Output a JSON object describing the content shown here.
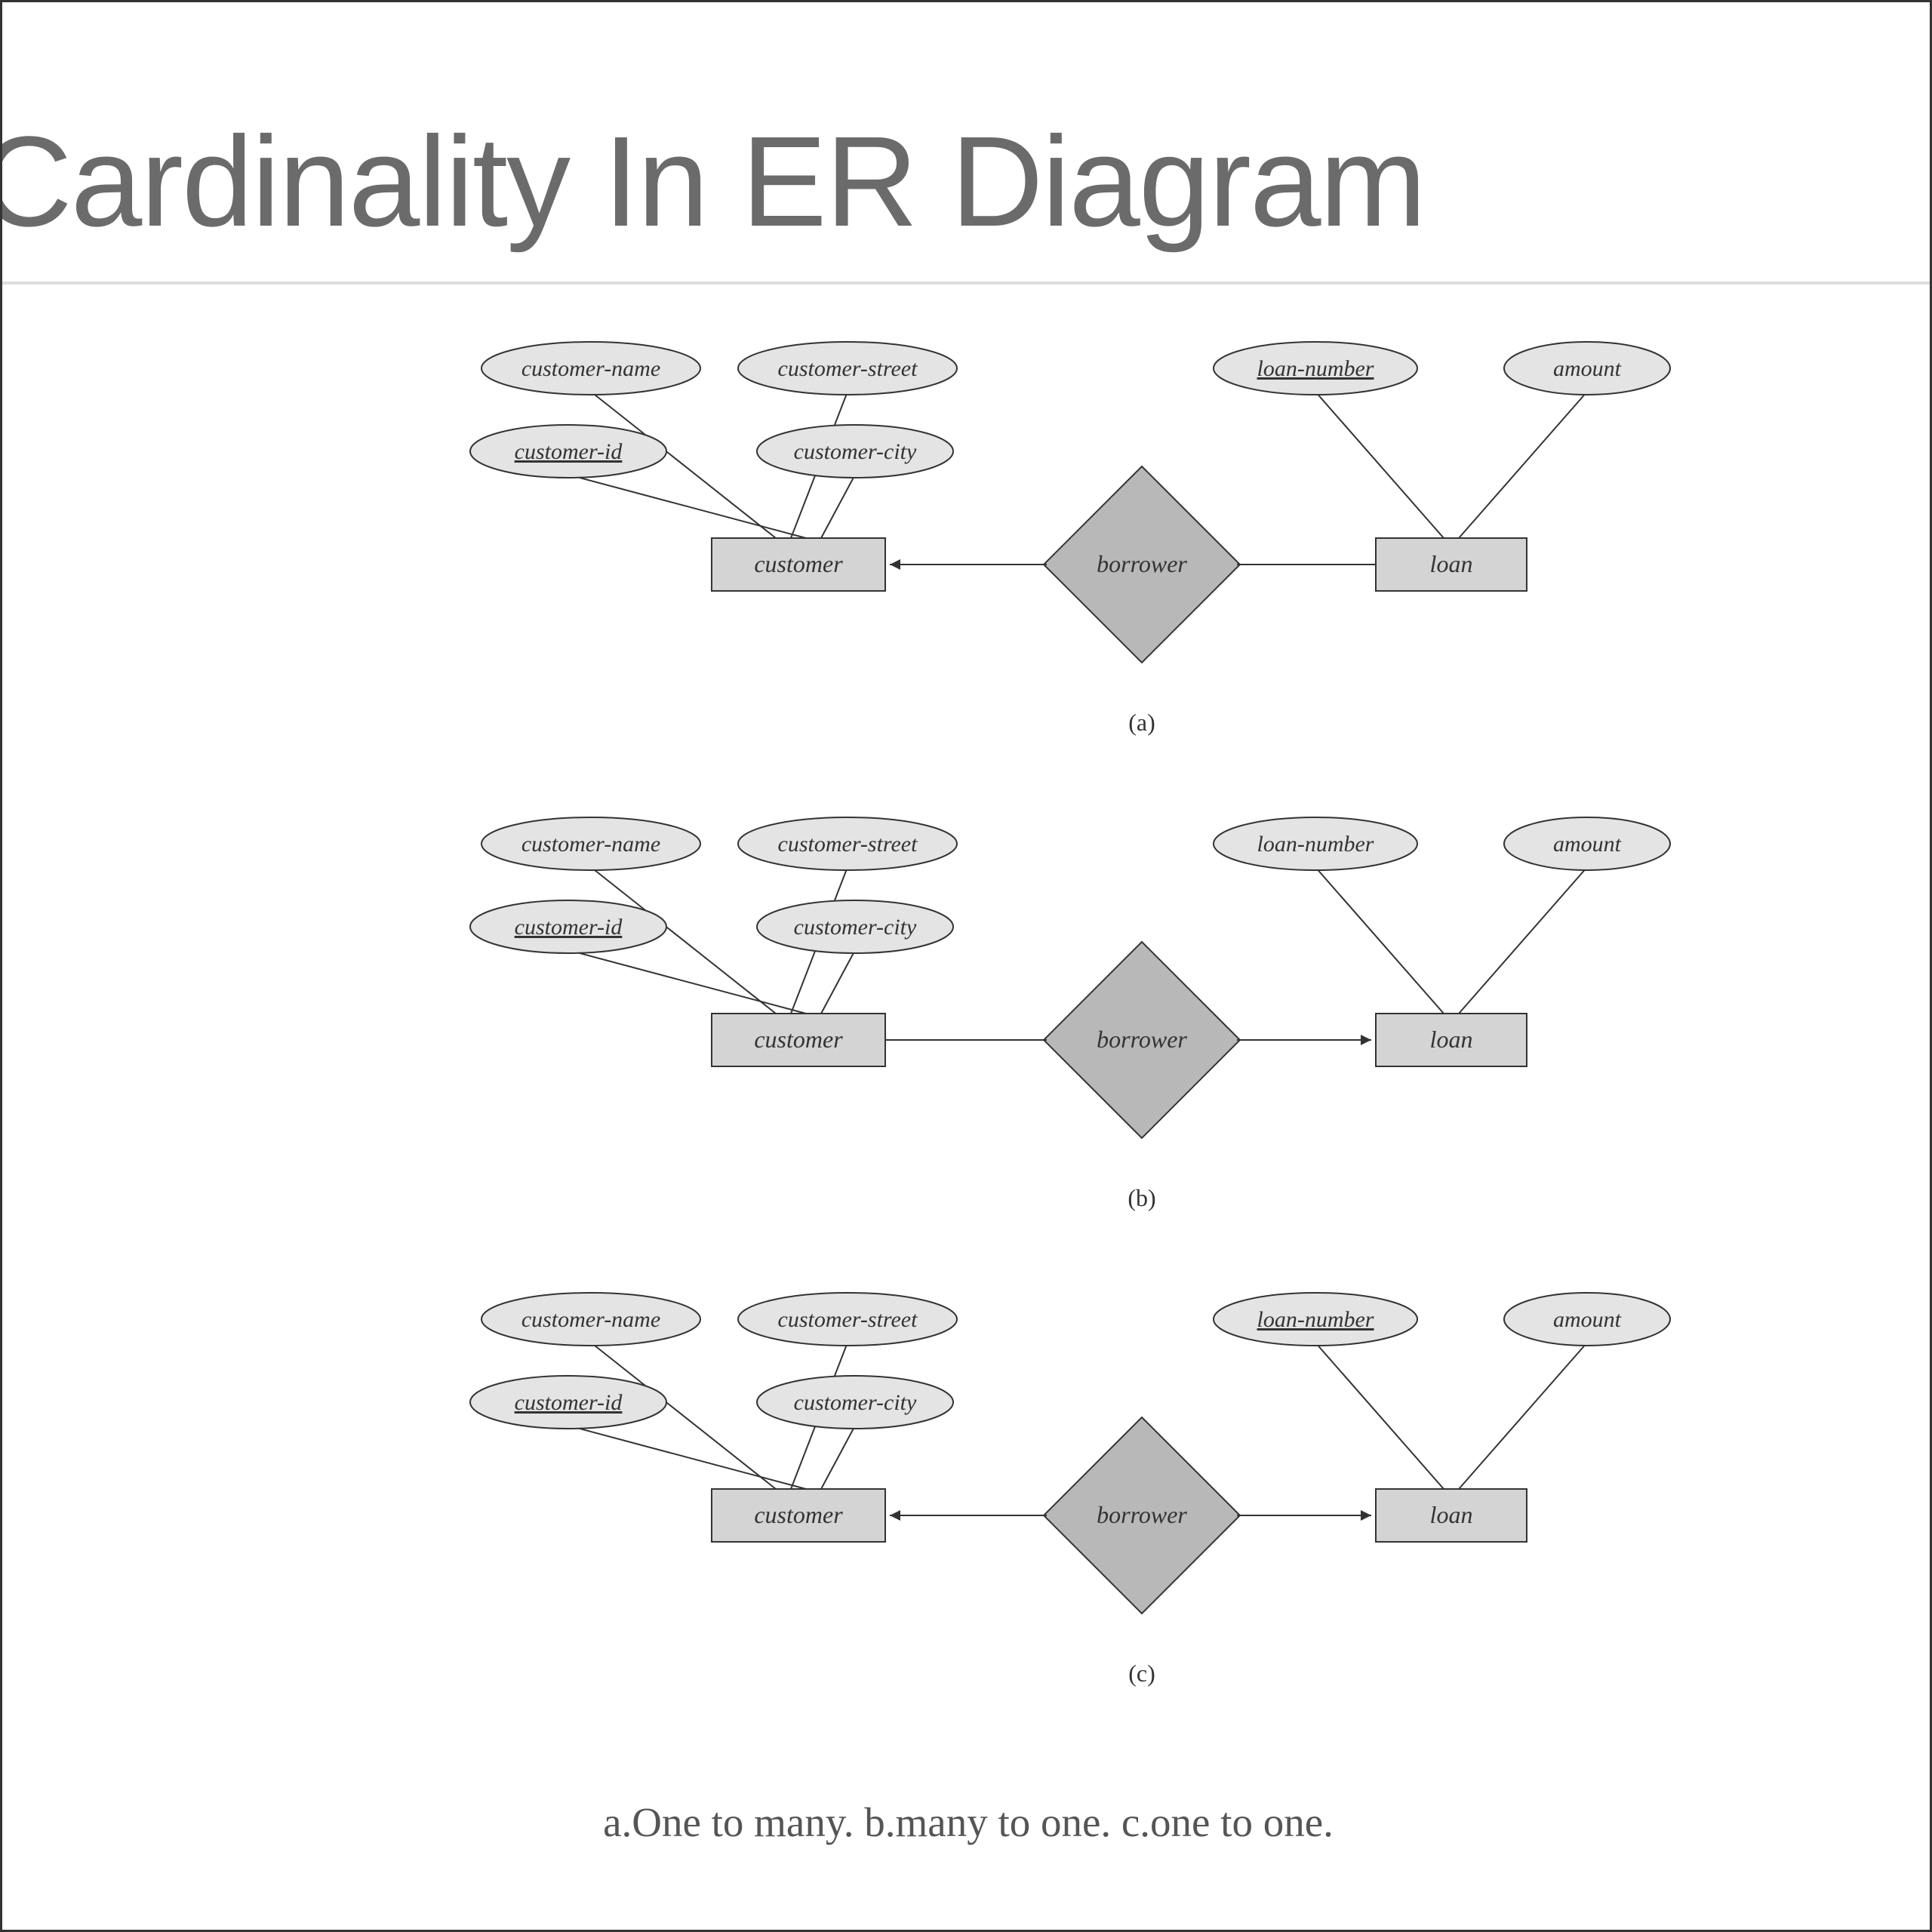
{
  "title": "Cardinality In ER Diagram",
  "caption": "a.One to many. b.many to one. c.one to one.",
  "diagrams": [
    {
      "label": "(a)",
      "entities": {
        "customer": {
          "text": "customer",
          "attrs": [
            {
              "text": "customer-name",
              "underline": false
            },
            {
              "text": "customer-street",
              "underline": false
            },
            {
              "text": "customer-id",
              "underline": true
            },
            {
              "text": "customer-city",
              "underline": false
            }
          ]
        },
        "loan": {
          "text": "loan",
          "attrs": [
            {
              "text": "loan-number",
              "underline": true
            },
            {
              "text": "amount",
              "underline": false
            }
          ]
        }
      },
      "relationship": "borrower",
      "arrowLeft": true,
      "arrowRight": false
    },
    {
      "label": "(b)",
      "entities": {
        "customer": {
          "text": "customer",
          "attrs": [
            {
              "text": "customer-name",
              "underline": false
            },
            {
              "text": "customer-street",
              "underline": false
            },
            {
              "text": "customer-id",
              "underline": true
            },
            {
              "text": "customer-city",
              "underline": false
            }
          ]
        },
        "loan": {
          "text": "loan",
          "attrs": [
            {
              "text": "loan-number",
              "underline": false
            },
            {
              "text": "amount",
              "underline": false
            }
          ]
        }
      },
      "relationship": "borrower",
      "arrowLeft": false,
      "arrowRight": true
    },
    {
      "label": "(c)",
      "entities": {
        "customer": {
          "text": "customer",
          "attrs": [
            {
              "text": "customer-name",
              "underline": false
            },
            {
              "text": "customer-street",
              "underline": false
            },
            {
              "text": "customer-id",
              "underline": true
            },
            {
              "text": "customer-city",
              "underline": false
            }
          ]
        },
        "loan": {
          "text": "loan",
          "attrs": [
            {
              "text": "loan-number",
              "underline": true
            },
            {
              "text": "amount",
              "underline": false
            }
          ]
        }
      },
      "relationship": "borrower",
      "arrowLeft": true,
      "arrowRight": true
    }
  ]
}
